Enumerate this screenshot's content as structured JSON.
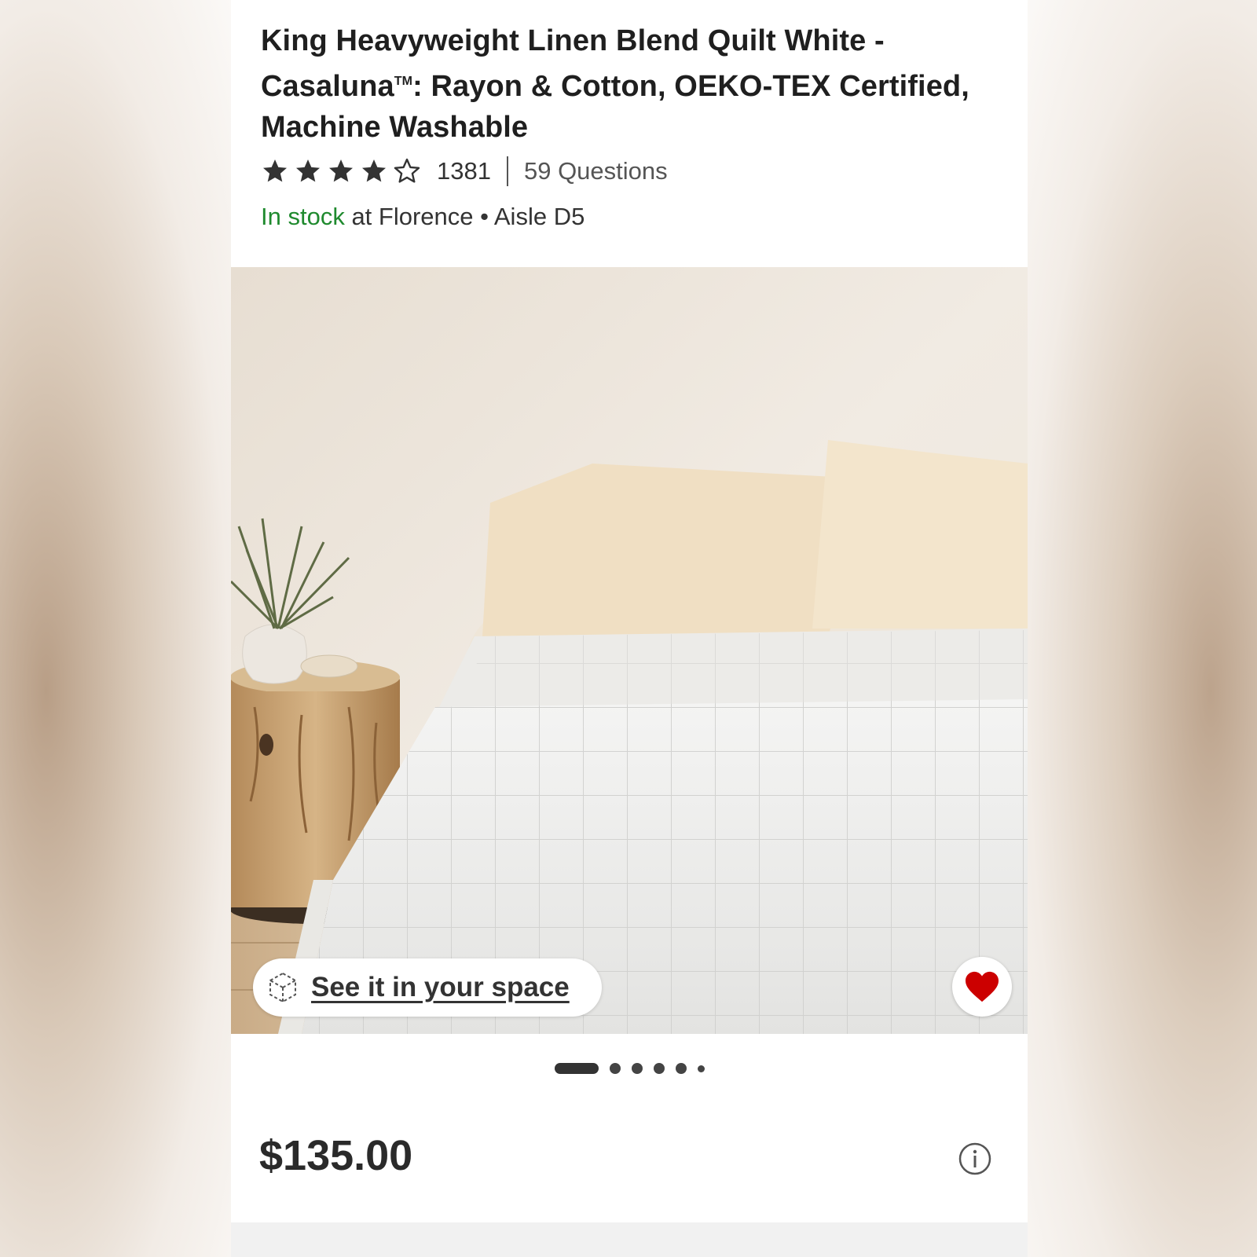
{
  "product": {
    "title_part1": "King Heavyweight Linen Blend Quilt White - Casaluna",
    "title_tm": "TM",
    "title_part2": ": Rayon & Cotton, OEKO-TEX Certified, Machine Washable",
    "rating": 4,
    "rating_max": 5,
    "rating_count": "1381",
    "questions_label": "59 Questions"
  },
  "availability": {
    "status": "In stock",
    "location_text": " at Florence • Aisle D5",
    "status_color": "#1f8a2e"
  },
  "gallery": {
    "see_in_space_label": "See it in your space",
    "see_in_space_icon": "ar-cube-icon",
    "favorite_icon": "heart-icon",
    "favorite_color": "#cc0000",
    "slide_count": 6,
    "active_slide": 1
  },
  "pricing": {
    "price": "$135.00",
    "info_icon": "info-icon"
  }
}
